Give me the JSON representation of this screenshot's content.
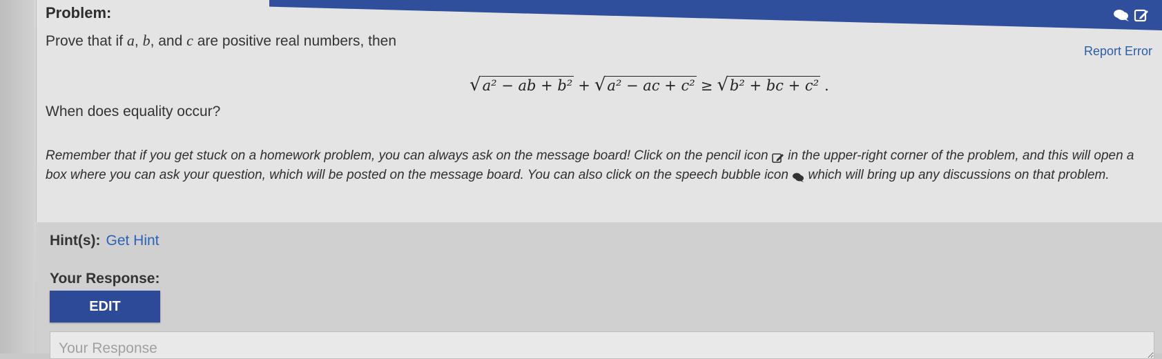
{
  "problem": {
    "label": "Problem:",
    "statement_prefix": "Prove that if ",
    "var_a": "a",
    "sep1": ", ",
    "var_b": "b",
    "sep2": ", and ",
    "var_c": "c",
    "statement_suffix": " are positive real numbers, then",
    "equation": {
      "term1": "a² − ab + b²",
      "plus": "+",
      "term2": "a² − ac + c²",
      "geq": "≥",
      "term3": "b² + bc + c²",
      "end": "."
    },
    "question": "When does equality occur?",
    "reminder_part1": "Remember that if you get stuck on a homework problem, you can always ask on the message board! Click on the pencil icon",
    "reminder_part2": "in the upper-right corner of the problem, and this will open a box where you can ask your question, which will be posted on the message board. You can also click on the speech bubble icon",
    "reminder_part3": "which will bring up any discussions on that problem."
  },
  "header": {
    "report_error": "Report Error",
    "icons": [
      "speech-bubble-icon",
      "pencil-icon"
    ]
  },
  "hint": {
    "label": "Hint(s):",
    "link": "Get Hint"
  },
  "response": {
    "label": "Your Response:",
    "edit_button": "EDIT",
    "placeholder": "Your Response"
  },
  "colors": {
    "header_blue": "#2f4f9c",
    "link_blue": "#2a63b8",
    "button_blue": "#2d4a99"
  }
}
